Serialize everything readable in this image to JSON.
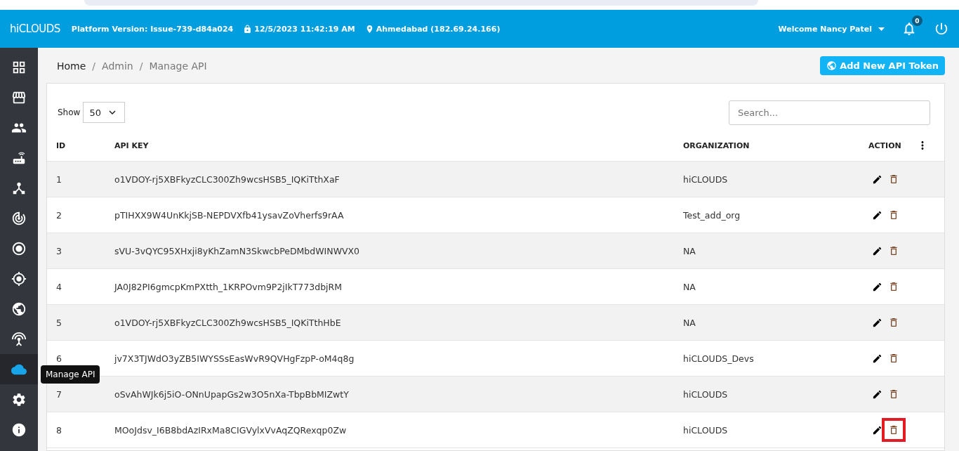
{
  "header": {
    "brand": "hiCLOUDS",
    "platform_version": "Platform Version: Issue-739-d84a024",
    "datetime": "12/5/2023 11:42:19 AM",
    "location": "Ahmedabad (182.69.24.166)",
    "welcome": "Welcome Nancy Patel",
    "notification_count": "0"
  },
  "sidebar": {
    "items": [
      {
        "selected": false
      },
      {
        "selected": false
      },
      {
        "selected": false
      },
      {
        "selected": false
      },
      {
        "selected": false
      },
      {
        "selected": false
      },
      {
        "selected": false
      },
      {
        "selected": false
      },
      {
        "selected": false
      },
      {
        "selected": false
      },
      {
        "selected": true
      },
      {
        "selected": false
      },
      {
        "selected": false
      }
    ],
    "tooltip": "Manage API"
  },
  "breadcrumb": {
    "items": [
      "Home",
      "Admin",
      "Manage API"
    ],
    "separator": "/"
  },
  "add_button": "Add New API Token",
  "show": {
    "label": "Show",
    "value": "50"
  },
  "search": {
    "placeholder": "Search..."
  },
  "table": {
    "columns": [
      "ID",
      "API KEY",
      "ORGANIZATION",
      "ACTION"
    ],
    "rows": [
      {
        "id": "1",
        "api_key": "o1VDOY-rj5XBFkyzCLC300Zh9wcsHSB5_IQKiTthXaF",
        "organization": "hiCLOUDS",
        "delete_highlighted": false
      },
      {
        "id": "2",
        "api_key": "pTIHXX9W4UnKkjSB-NEPDVXfb41ysavZoVherfs9rAA",
        "organization": "Test_add_org",
        "delete_highlighted": false
      },
      {
        "id": "3",
        "api_key": "sVU-3vQYC95XHxji8yKhZamN3SkwcbPeDMbdWINWVX0",
        "organization": "NA",
        "delete_highlighted": false
      },
      {
        "id": "4",
        "api_key": "JA0J82PI6gmcpKmPXtth_1KRPOvm9P2jIkT773dbjRM",
        "organization": "NA",
        "delete_highlighted": false
      },
      {
        "id": "5",
        "api_key": "o1VDOY-rj5XBFkyzCLC300Zh9wcsHSB5_IQKiTthHbE",
        "organization": "NA",
        "delete_highlighted": false
      },
      {
        "id": "6",
        "api_key": "jv7X3TJWdO3yZB5IWYSSsEasWvR9QVHgFzpP-oM4q8g",
        "organization": "hiCLOUDS_Devs",
        "delete_highlighted": false
      },
      {
        "id": "7",
        "api_key": "oSvAhWJk6j5iO-ONnUpapGs2w3O5nXa-TbpBbMIZwtY",
        "organization": "hiCLOUDS",
        "delete_highlighted": false
      },
      {
        "id": "8",
        "api_key": "MOoJdsv_I6B8bdAzIRxMa8CIGVylxVvAqZQRexqp0Zw",
        "organization": "hiCLOUDS",
        "delete_highlighted": true
      }
    ]
  }
}
